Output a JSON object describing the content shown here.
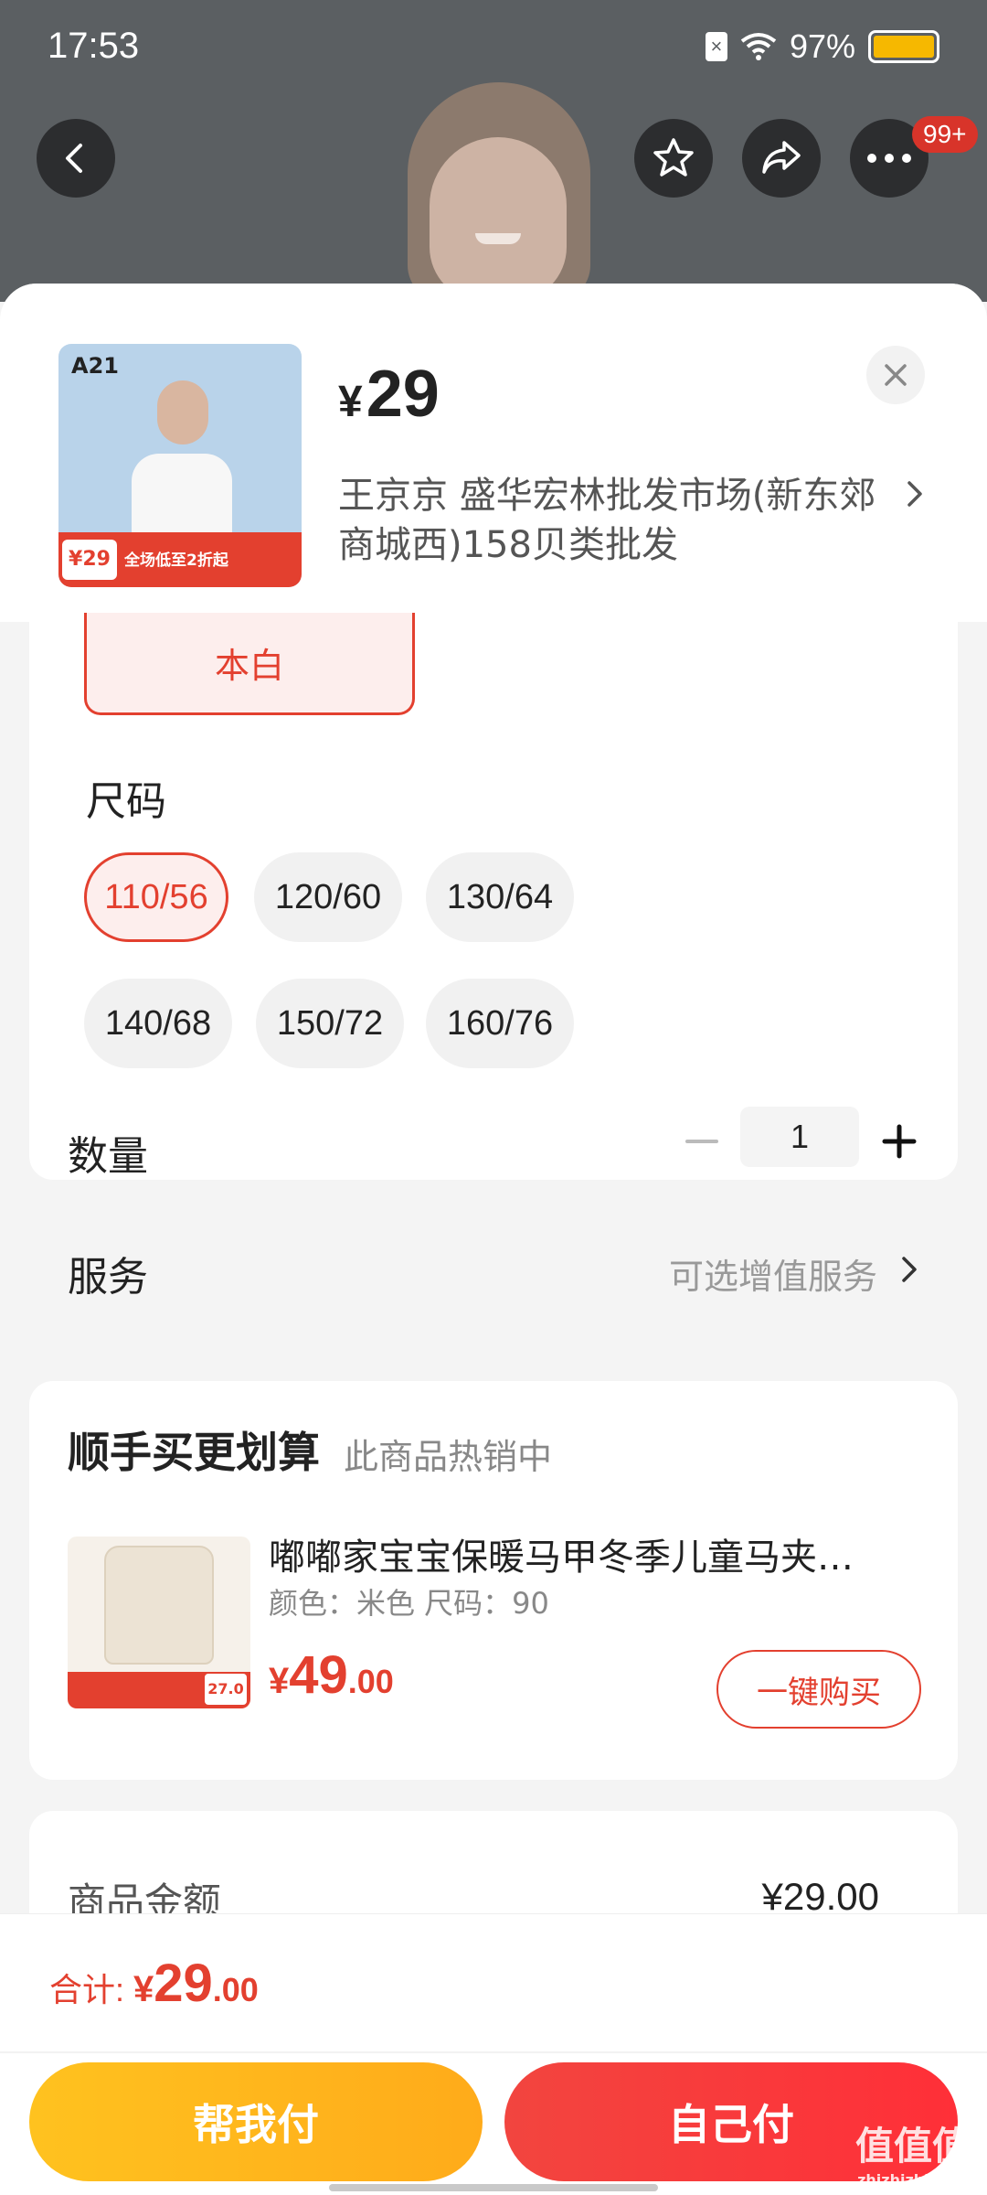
{
  "status_bar": {
    "time": "17:53",
    "battery": "97%"
  },
  "header": {
    "badge": "99+"
  },
  "product": {
    "thumb_brand": "A21",
    "thumb_promo_price": "¥29",
    "thumb_promo_text": "全场低至2折起",
    "price_symbol": "¥",
    "price": "29",
    "shop_name": "王京京  盛华宏林批发市场(新东郊商城西)158贝类批发"
  },
  "spec": {
    "selected_color": "本白",
    "size_title": "尺码",
    "sizes": [
      "110/56",
      "120/60",
      "130/64",
      "140/68",
      "150/72",
      "160/76"
    ],
    "selected_size": "110/56"
  },
  "quantity": {
    "label": "数量",
    "value": "1"
  },
  "service": {
    "label": "服务",
    "value": "可选增值服务"
  },
  "upsell": {
    "title": "顺手买更划算",
    "subtitle": "此商品热销中",
    "item_name": "嘟嘟家宝宝保暖马甲冬季儿童马夹…",
    "item_attrs": "颜色：米色    尺码：90",
    "price_symbol": "¥",
    "price_int": "49",
    "price_dec": ".00",
    "promo_price": "27.0",
    "buy_label": "一键购买"
  },
  "amount": {
    "label": "商品金额",
    "value": "¥29.00"
  },
  "bottom": {
    "total_label": "合计: ",
    "total_symbol": "¥",
    "total_int": "29",
    "total_dec": ".00",
    "pay_friend": "帮我付",
    "pay_self": "自己付"
  },
  "watermark": {
    "text": "值值值",
    "url": "zhizhizhi.com"
  },
  "colors": {
    "accent": "#e3402f",
    "friend_pay": "#ffb81c",
    "self_pay": "#f7343c"
  }
}
